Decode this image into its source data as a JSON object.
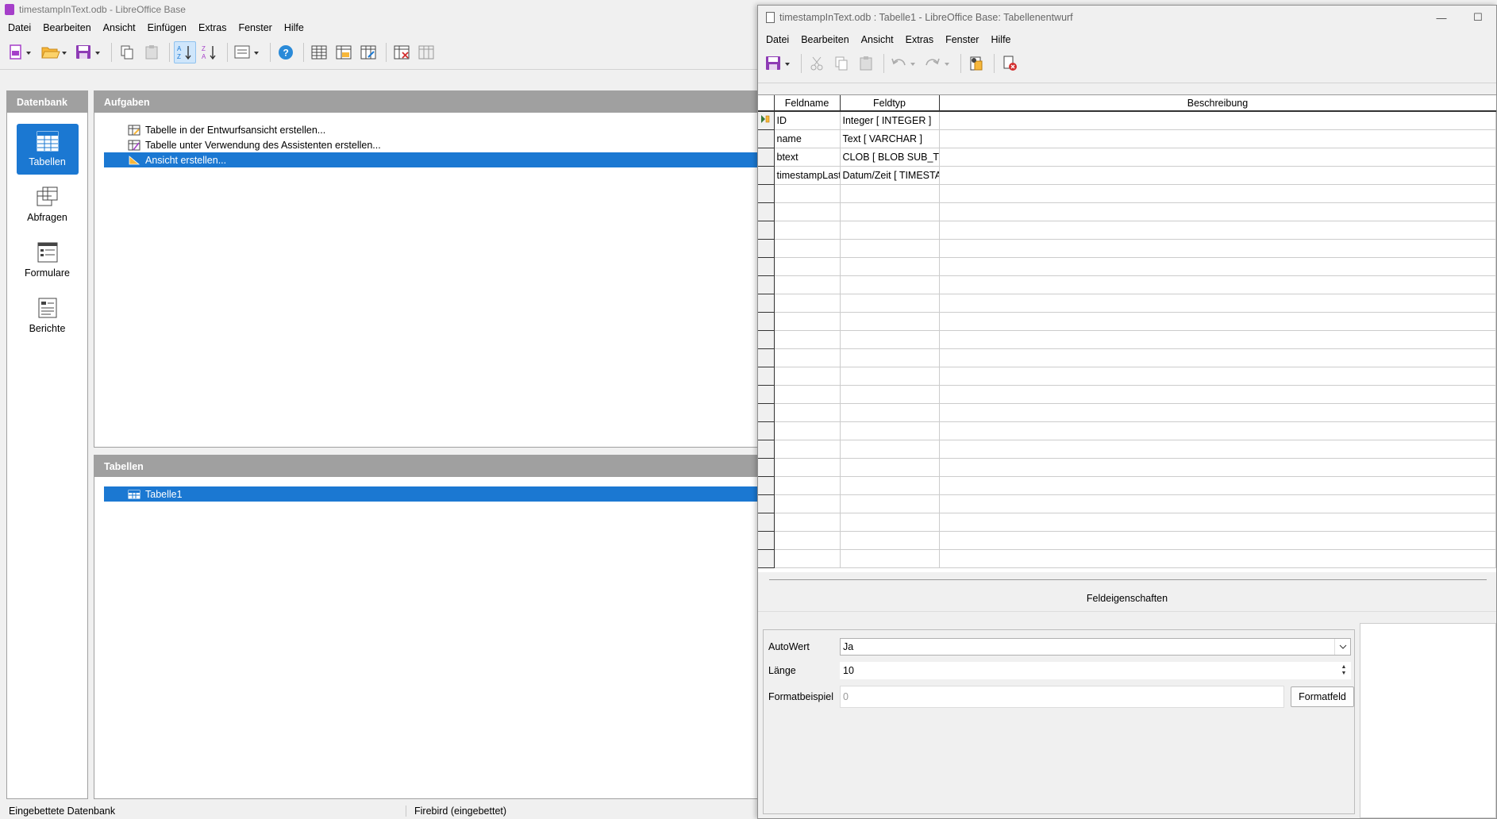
{
  "main": {
    "title": "timestampInText.odb - LibreOffice Base",
    "menu": [
      "Datei",
      "Bearbeiten",
      "Ansicht",
      "Einfügen",
      "Extras",
      "Fenster",
      "Hilfe"
    ],
    "database_header": "Datenbank",
    "nav": [
      {
        "label": "Tabellen",
        "icon": "table-icon",
        "selected": true
      },
      {
        "label": "Abfragen",
        "icon": "query-icon",
        "selected": false
      },
      {
        "label": "Formulare",
        "icon": "form-icon",
        "selected": false
      },
      {
        "label": "Berichte",
        "icon": "report-icon",
        "selected": false
      }
    ],
    "tasks_header": "Aufgaben",
    "tasks": [
      {
        "label": "Tabelle in der Entwurfsansicht erstellen...",
        "selected": false
      },
      {
        "label": "Tabelle unter Verwendung des Assistenten erstellen...",
        "selected": false
      },
      {
        "label": "Ansicht erstellen...",
        "selected": true
      }
    ],
    "tables_header": "Tabellen",
    "tables": [
      "Tabelle1"
    ],
    "status_left": "Eingebettete Datenbank",
    "status_right": "Firebird (eingebettet)",
    "accent": "#1b78d2"
  },
  "design": {
    "title": "timestampInText.odb : Tabelle1 - LibreOffice Base: Tabellenentwurf",
    "menu": [
      "Datei",
      "Bearbeiten",
      "Ansicht",
      "Extras",
      "Fenster",
      "Hilfe"
    ],
    "columns": [
      "Feldname",
      "Feldtyp",
      "Beschreibung"
    ],
    "rows": [
      {
        "name": "ID",
        "type": "Integer [ INTEGER ]",
        "desc": "",
        "primary": true
      },
      {
        "name": "name",
        "type": "Text [ VARCHAR ]",
        "desc": ""
      },
      {
        "name": "btext",
        "type": "CLOB [ BLOB SUB_TYPE TEXT ]",
        "desc": ""
      },
      {
        "name": "timestampLastChange",
        "type": "Datum/Zeit [ TIMESTAMP ]",
        "desc": ""
      }
    ],
    "field_props_title": "Feldeigenschaften",
    "props": {
      "autowert_label": "AutoWert",
      "autowert_value": "Ja",
      "laenge_label": "Länge",
      "laenge_value": "10",
      "format_label": "Formatbeispiel",
      "format_value": "0",
      "format_button": "Formatfeld"
    }
  }
}
